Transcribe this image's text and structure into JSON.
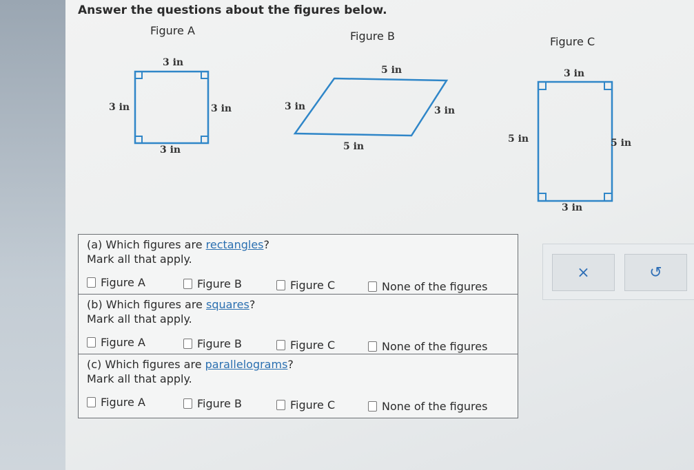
{
  "instructions": "Answer the questions about the figures below.",
  "figures": {
    "a": {
      "title": "Figure A",
      "top": "3 in",
      "bottom": "3 in",
      "left": "3 in",
      "right": "3 in"
    },
    "b": {
      "title": "Figure B",
      "top": "5 in",
      "bottom": "5 in",
      "left": "3 in",
      "right": "3 in"
    },
    "c": {
      "title": "Figure C",
      "top": "3 in",
      "bottom": "3 in",
      "left": "5 in",
      "right": "5 in"
    }
  },
  "questions": [
    {
      "prefix": "(a) Which figures are ",
      "term": "rectangles",
      "suffix": "?",
      "subtext": "Mark all that apply."
    },
    {
      "prefix": "(b) Which figures are ",
      "term": "squares",
      "suffix": "?",
      "subtext": "Mark all that apply."
    },
    {
      "prefix": "(c) Which figures are ",
      "term": "parallelograms",
      "suffix": "?",
      "subtext": "Mark all that apply."
    }
  ],
  "options": [
    "Figure A",
    "Figure B",
    "Figure C",
    "None of the figures"
  ],
  "actions": {
    "clear_icon": "x-icon",
    "clear_glyph": "×",
    "undo_icon": "undo-icon",
    "undo_glyph": "↺"
  },
  "colors": {
    "figure_stroke": "#2f86c8",
    "link": "#2a6fb0"
  }
}
